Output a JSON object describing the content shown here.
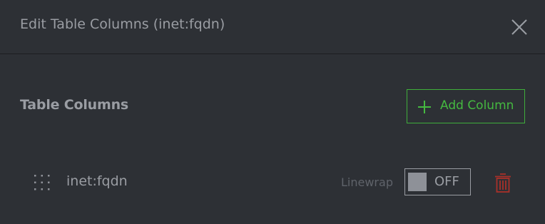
{
  "dialog": {
    "title": "Edit Table Columns (inet:fqdn)",
    "close_icon": "close-icon"
  },
  "section": {
    "title": "Table Columns",
    "add_button_label": "Add Column",
    "add_icon": "plus-icon"
  },
  "columns": [
    {
      "name": "inet:fqdn",
      "drag_icon": "drag-handle-icon",
      "linewrap_label": "Linewrap",
      "linewrap_state": "OFF",
      "delete_icon": "trash-icon"
    }
  ],
  "colors": {
    "background": "#2d3035",
    "text": "#9a9da3",
    "accent_green": "#45b940",
    "delete_red": "#a9302a"
  }
}
